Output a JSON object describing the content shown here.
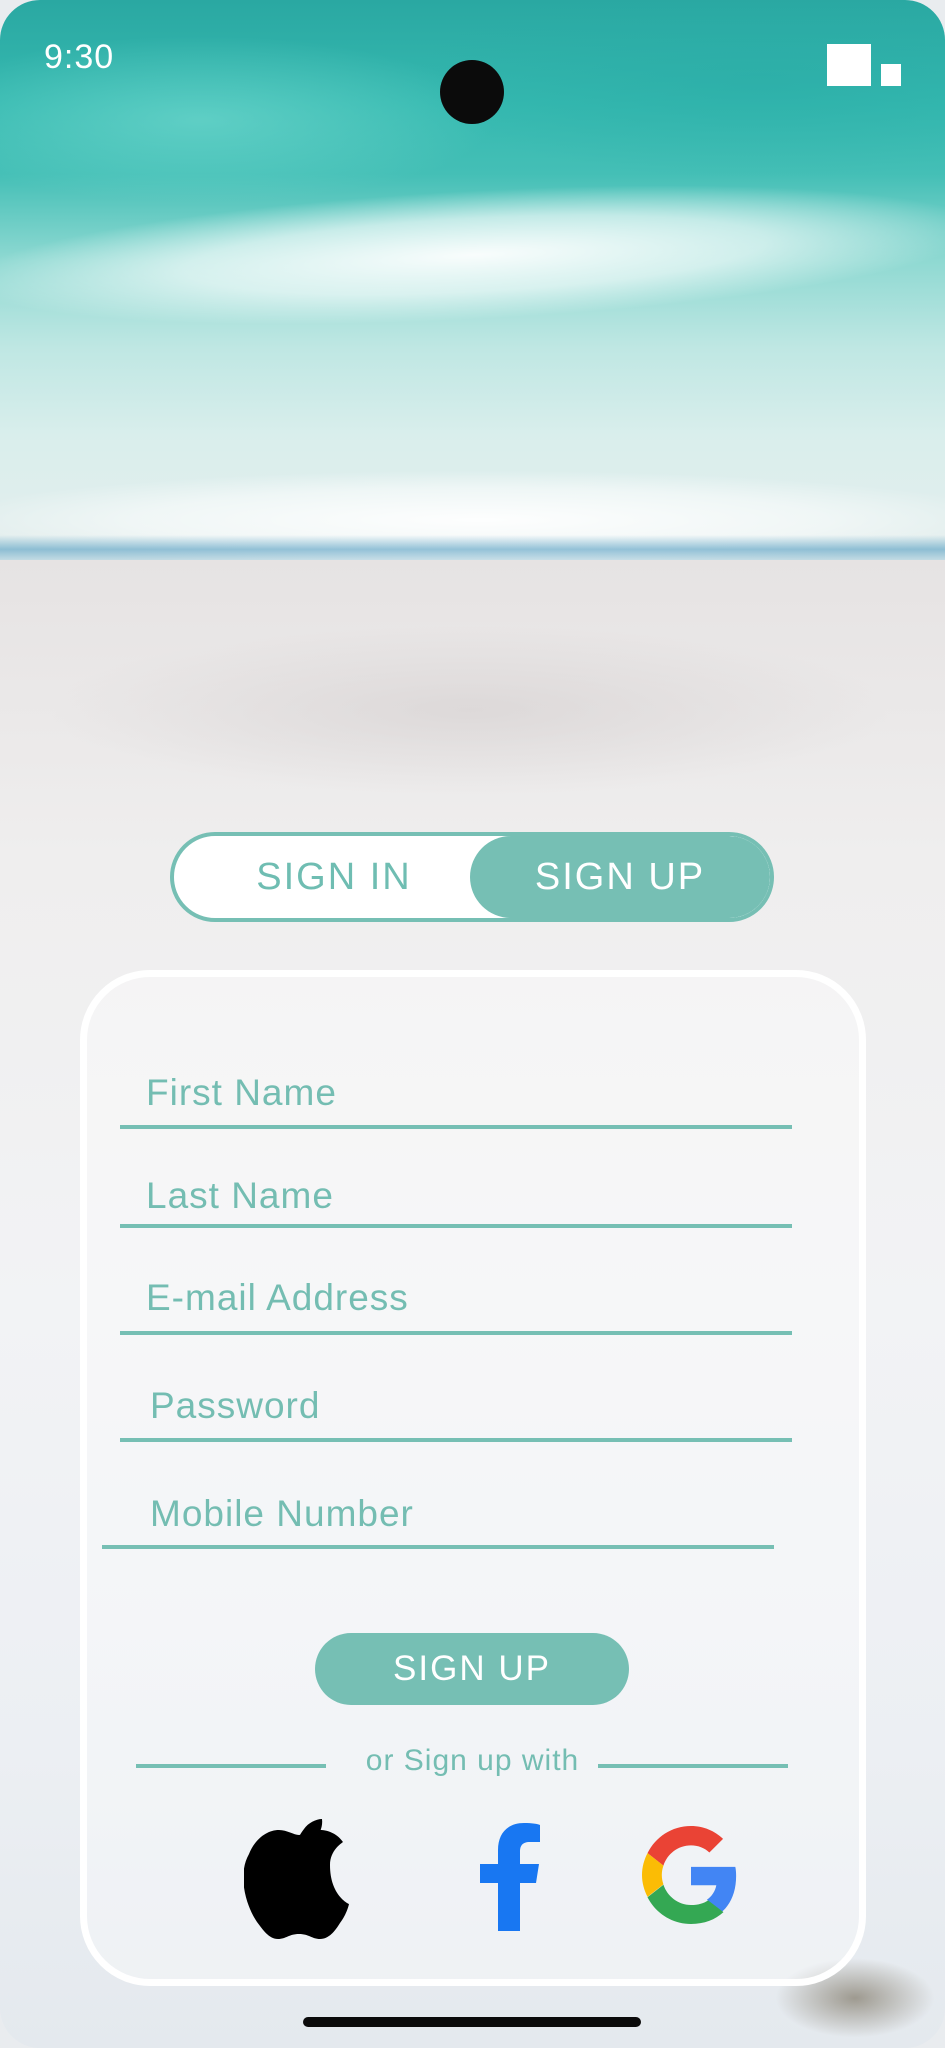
{
  "status_bar": {
    "time": "9:30"
  },
  "auth_toggle": {
    "sign_in_label": "SIGN IN",
    "sign_up_label": "SIGN UP",
    "active": "SIGN UP"
  },
  "form": {
    "fields": [
      {
        "label": "First Name"
      },
      {
        "label": "Last Name"
      },
      {
        "label": "E-mail Address"
      },
      {
        "label": "Password"
      },
      {
        "label": "Mobile Number"
      }
    ],
    "submit_label": "SIGN UP",
    "divider_text": "or Sign up with",
    "social": [
      "apple-icon",
      "facebook-icon",
      "google-icon"
    ]
  },
  "colors": {
    "accent": "#76bfb4",
    "accent_text": "#74bdb2",
    "facebook_blue": "#1877f2"
  }
}
